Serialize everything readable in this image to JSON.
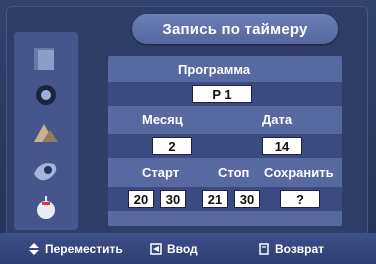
{
  "title": "Запись по таймеру",
  "program": {
    "label": "Программа",
    "value": "P 1"
  },
  "month": {
    "label": "Месяц",
    "value": "2"
  },
  "date": {
    "label": "Дата",
    "value": "14"
  },
  "start": {
    "label": "Старт",
    "hour": "20",
    "minute": "30"
  },
  "stop": {
    "label": "Стоп",
    "hour": "21",
    "minute": "30"
  },
  "save": {
    "label": "Сохранить",
    "value": "?"
  },
  "footer": {
    "move": "Переместить",
    "enter": "Ввод",
    "back": "Возврат"
  },
  "colors": {
    "background": "#2c3a63",
    "panel": "#5869a2",
    "accent": "#6d7fb8"
  },
  "sidebar": {
    "icons": [
      "picture-icon",
      "sound-icon",
      "channel-icon",
      "setup-icon",
      "input-icon"
    ]
  }
}
